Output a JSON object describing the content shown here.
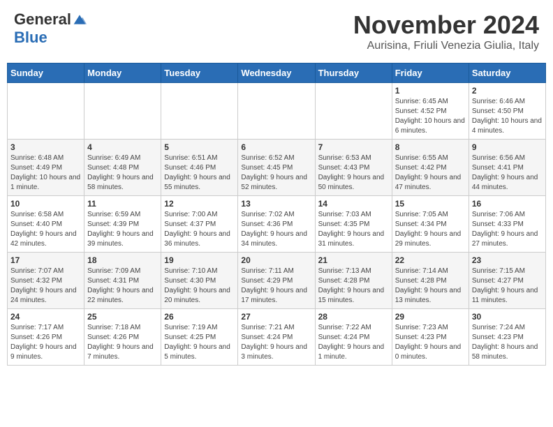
{
  "header": {
    "logo_general": "General",
    "logo_blue": "Blue",
    "month_title": "November 2024",
    "subtitle": "Aurisina, Friuli Venezia Giulia, Italy"
  },
  "days_of_week": [
    "Sunday",
    "Monday",
    "Tuesday",
    "Wednesday",
    "Thursday",
    "Friday",
    "Saturday"
  ],
  "weeks": [
    [
      {
        "day": "",
        "info": ""
      },
      {
        "day": "",
        "info": ""
      },
      {
        "day": "",
        "info": ""
      },
      {
        "day": "",
        "info": ""
      },
      {
        "day": "",
        "info": ""
      },
      {
        "day": "1",
        "info": "Sunrise: 6:45 AM\nSunset: 4:52 PM\nDaylight: 10 hours and 6 minutes."
      },
      {
        "day": "2",
        "info": "Sunrise: 6:46 AM\nSunset: 4:50 PM\nDaylight: 10 hours and 4 minutes."
      }
    ],
    [
      {
        "day": "3",
        "info": "Sunrise: 6:48 AM\nSunset: 4:49 PM\nDaylight: 10 hours and 1 minute."
      },
      {
        "day": "4",
        "info": "Sunrise: 6:49 AM\nSunset: 4:48 PM\nDaylight: 9 hours and 58 minutes."
      },
      {
        "day": "5",
        "info": "Sunrise: 6:51 AM\nSunset: 4:46 PM\nDaylight: 9 hours and 55 minutes."
      },
      {
        "day": "6",
        "info": "Sunrise: 6:52 AM\nSunset: 4:45 PM\nDaylight: 9 hours and 52 minutes."
      },
      {
        "day": "7",
        "info": "Sunrise: 6:53 AM\nSunset: 4:43 PM\nDaylight: 9 hours and 50 minutes."
      },
      {
        "day": "8",
        "info": "Sunrise: 6:55 AM\nSunset: 4:42 PM\nDaylight: 9 hours and 47 minutes."
      },
      {
        "day": "9",
        "info": "Sunrise: 6:56 AM\nSunset: 4:41 PM\nDaylight: 9 hours and 44 minutes."
      }
    ],
    [
      {
        "day": "10",
        "info": "Sunrise: 6:58 AM\nSunset: 4:40 PM\nDaylight: 9 hours and 42 minutes."
      },
      {
        "day": "11",
        "info": "Sunrise: 6:59 AM\nSunset: 4:39 PM\nDaylight: 9 hours and 39 minutes."
      },
      {
        "day": "12",
        "info": "Sunrise: 7:00 AM\nSunset: 4:37 PM\nDaylight: 9 hours and 36 minutes."
      },
      {
        "day": "13",
        "info": "Sunrise: 7:02 AM\nSunset: 4:36 PM\nDaylight: 9 hours and 34 minutes."
      },
      {
        "day": "14",
        "info": "Sunrise: 7:03 AM\nSunset: 4:35 PM\nDaylight: 9 hours and 31 minutes."
      },
      {
        "day": "15",
        "info": "Sunrise: 7:05 AM\nSunset: 4:34 PM\nDaylight: 9 hours and 29 minutes."
      },
      {
        "day": "16",
        "info": "Sunrise: 7:06 AM\nSunset: 4:33 PM\nDaylight: 9 hours and 27 minutes."
      }
    ],
    [
      {
        "day": "17",
        "info": "Sunrise: 7:07 AM\nSunset: 4:32 PM\nDaylight: 9 hours and 24 minutes."
      },
      {
        "day": "18",
        "info": "Sunrise: 7:09 AM\nSunset: 4:31 PM\nDaylight: 9 hours and 22 minutes."
      },
      {
        "day": "19",
        "info": "Sunrise: 7:10 AM\nSunset: 4:30 PM\nDaylight: 9 hours and 20 minutes."
      },
      {
        "day": "20",
        "info": "Sunrise: 7:11 AM\nSunset: 4:29 PM\nDaylight: 9 hours and 17 minutes."
      },
      {
        "day": "21",
        "info": "Sunrise: 7:13 AM\nSunset: 4:28 PM\nDaylight: 9 hours and 15 minutes."
      },
      {
        "day": "22",
        "info": "Sunrise: 7:14 AM\nSunset: 4:28 PM\nDaylight: 9 hours and 13 minutes."
      },
      {
        "day": "23",
        "info": "Sunrise: 7:15 AM\nSunset: 4:27 PM\nDaylight: 9 hours and 11 minutes."
      }
    ],
    [
      {
        "day": "24",
        "info": "Sunrise: 7:17 AM\nSunset: 4:26 PM\nDaylight: 9 hours and 9 minutes."
      },
      {
        "day": "25",
        "info": "Sunrise: 7:18 AM\nSunset: 4:26 PM\nDaylight: 9 hours and 7 minutes."
      },
      {
        "day": "26",
        "info": "Sunrise: 7:19 AM\nSunset: 4:25 PM\nDaylight: 9 hours and 5 minutes."
      },
      {
        "day": "27",
        "info": "Sunrise: 7:21 AM\nSunset: 4:24 PM\nDaylight: 9 hours and 3 minutes."
      },
      {
        "day": "28",
        "info": "Sunrise: 7:22 AM\nSunset: 4:24 PM\nDaylight: 9 hours and 1 minute."
      },
      {
        "day": "29",
        "info": "Sunrise: 7:23 AM\nSunset: 4:23 PM\nDaylight: 9 hours and 0 minutes."
      },
      {
        "day": "30",
        "info": "Sunrise: 7:24 AM\nSunset: 4:23 PM\nDaylight: 8 hours and 58 minutes."
      }
    ]
  ]
}
